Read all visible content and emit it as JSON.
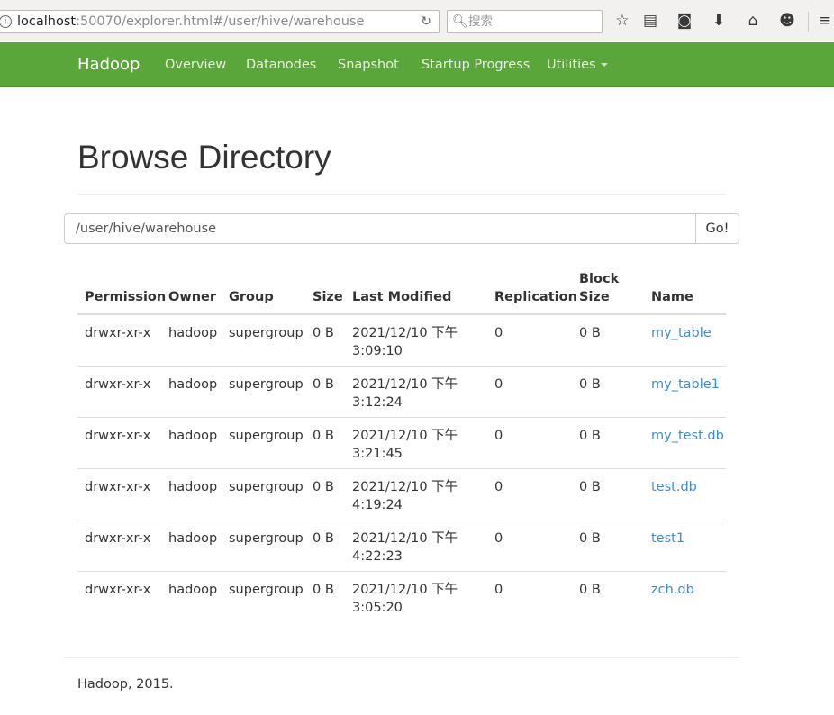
{
  "browser": {
    "url_host": "localhost",
    "url_rest": ":50070/explorer.html#/user/hive/warehouse",
    "search_placeholder": "搜索"
  },
  "navbar": {
    "brand": "Hadoop",
    "links": [
      "Overview",
      "Datanodes",
      "Snapshot",
      "Startup Progress",
      "Utilities"
    ]
  },
  "page": {
    "title": "Browse Directory",
    "path_value": "/user/hive/warehouse",
    "go_label": "Go!"
  },
  "table": {
    "headers": [
      "Permission",
      "Owner",
      "Group",
      "Size",
      "Last Modified",
      "Replication",
      "Block Size",
      "Name"
    ],
    "rows": [
      {
        "permission": "drwxr-xr-x",
        "owner": "hadoop",
        "group": "supergroup",
        "size": "0 B",
        "modified": "2021/12/10 下午 3:09:10",
        "replication": "0",
        "block_size": "0 B",
        "name": "my_table"
      },
      {
        "permission": "drwxr-xr-x",
        "owner": "hadoop",
        "group": "supergroup",
        "size": "0 B",
        "modified": "2021/12/10 下午 3:12:24",
        "replication": "0",
        "block_size": "0 B",
        "name": "my_table1"
      },
      {
        "permission": "drwxr-xr-x",
        "owner": "hadoop",
        "group": "supergroup",
        "size": "0 B",
        "modified": "2021/12/10 下午 3:21:45",
        "replication": "0",
        "block_size": "0 B",
        "name": "my_test.db"
      },
      {
        "permission": "drwxr-xr-x",
        "owner": "hadoop",
        "group": "supergroup",
        "size": "0 B",
        "modified": "2021/12/10 下午 4:19:24",
        "replication": "0",
        "block_size": "0 B",
        "name": "test.db"
      },
      {
        "permission": "drwxr-xr-x",
        "owner": "hadoop",
        "group": "supergroup",
        "size": "0 B",
        "modified": "2021/12/10 下午 4:22:23",
        "replication": "0",
        "block_size": "0 B",
        "name": "test1"
      },
      {
        "permission": "drwxr-xr-x",
        "owner": "hadoop",
        "group": "supergroup",
        "size": "0 B",
        "modified": "2021/12/10 下午 3:05:20",
        "replication": "0",
        "block_size": "0 B",
        "name": "zch.db"
      }
    ]
  },
  "footer": {
    "text": "Hadoop, 2015."
  },
  "colors": {
    "navbar": "#5ba63b",
    "link": "#428bca"
  },
  "icons": [
    "info-icon",
    "reload-icon",
    "search-icon",
    "bookmark-star-icon",
    "reading-list-icon",
    "pocket-icon",
    "download-icon",
    "home-icon",
    "smiley-icon",
    "menu-icon"
  ]
}
